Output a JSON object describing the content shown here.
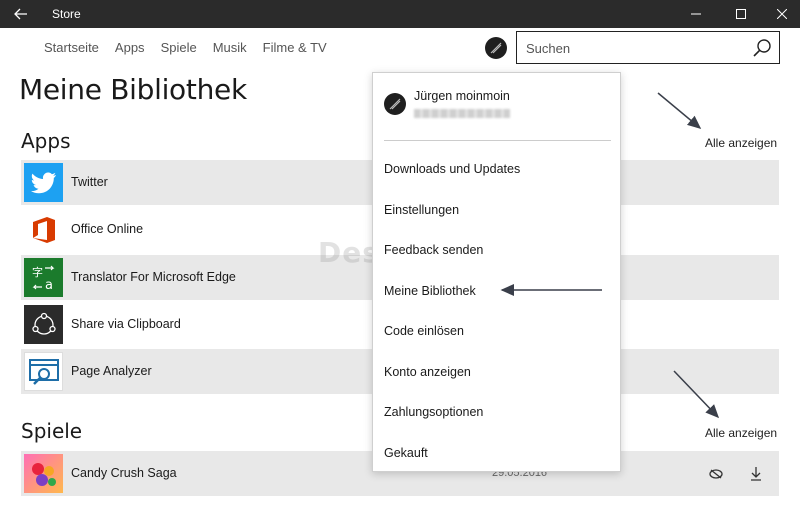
{
  "window": {
    "title": "Store"
  },
  "nav": {
    "items": [
      "Startseite",
      "Apps",
      "Spiele",
      "Musik",
      "Filme & TV"
    ]
  },
  "search": {
    "placeholder": "Suchen"
  },
  "page": {
    "title": "Meine Bibliothek"
  },
  "apps_section": {
    "title": "Apps",
    "see_all": "Alle anzeigen",
    "items": [
      {
        "name": "Twitter",
        "icon": "twitter-icon",
        "color": "#1da1f2"
      },
      {
        "name": "Office Online",
        "icon": "office-icon",
        "color": "#d83b01"
      },
      {
        "name": "Translator For Microsoft Edge",
        "icon": "translator-icon",
        "color": "#1b7b2c"
      },
      {
        "name": "Share via Clipboard",
        "icon": "share-icon",
        "color": "#2b2b2b"
      },
      {
        "name": "Page Analyzer",
        "icon": "page-analyzer-icon",
        "color": "#1e6ea8"
      }
    ]
  },
  "games_section": {
    "title": "Spiele",
    "see_all": "Alle anzeigen",
    "items": [
      {
        "name": "Candy Crush Saga",
        "icon": "candy-crush-icon",
        "date": "29.05.2016"
      }
    ]
  },
  "account_menu": {
    "user_name": "Jürgen moinmoin",
    "items": [
      "Downloads und Updates",
      "Einstellungen",
      "Feedback senden",
      "Meine Bibliothek",
      "Code einlösen",
      "Konto anzeigen",
      "Zahlungsoptionen",
      "Gekauft"
    ]
  },
  "watermark": "Deskmodder.de"
}
